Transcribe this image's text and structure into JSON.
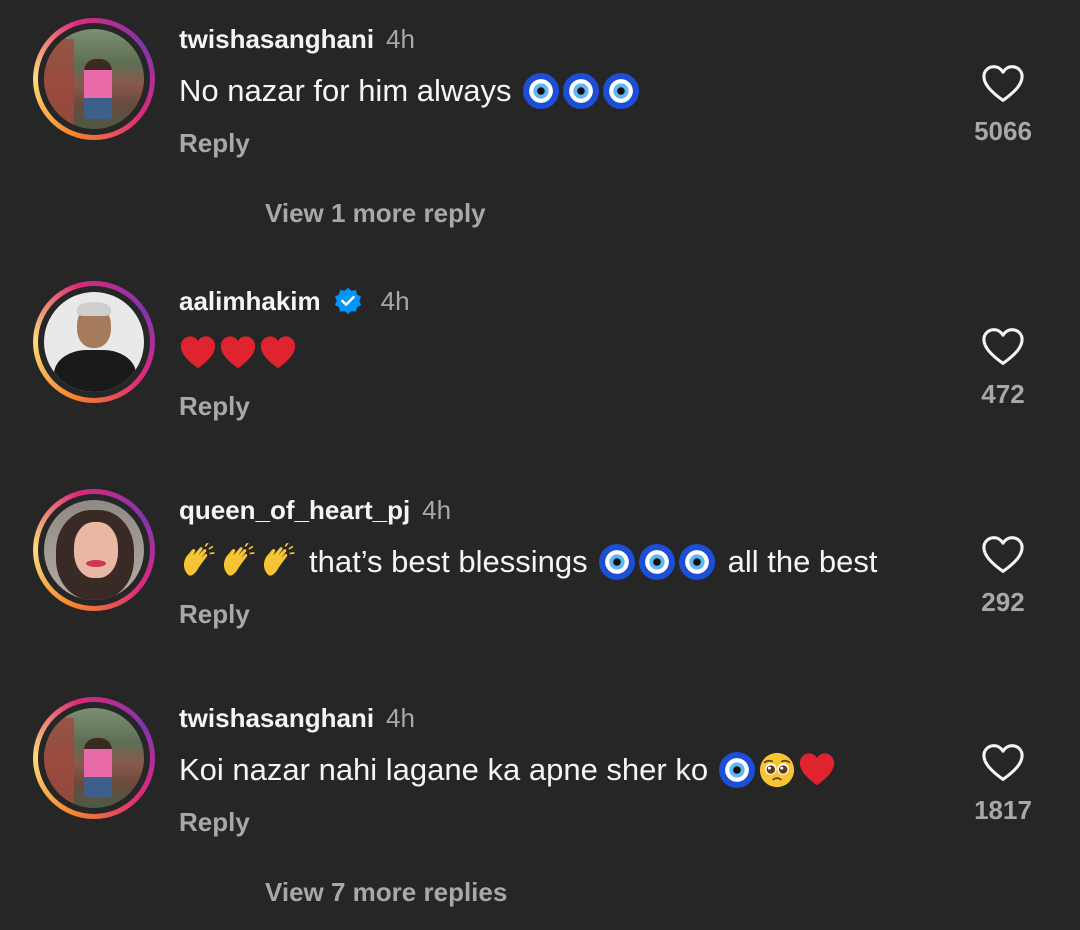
{
  "comments": [
    {
      "username": "twishasanghani",
      "time": "4h",
      "text": "No nazar for him always",
      "reply_label": "Reply",
      "likes": "5066",
      "view_more": "View 1 more reply"
    },
    {
      "username": "aalimhakim",
      "time": "4h",
      "verified": true,
      "reply_label": "Reply",
      "likes": "472"
    },
    {
      "username": "queen_of_heart_pj",
      "time": "4h",
      "text_a": "that’s best blessings",
      "text_b": "all the best",
      "reply_label": "Reply",
      "likes": "292"
    },
    {
      "username": "twishasanghani",
      "time": "4h",
      "text": "Koi nazar nahi lagane ka apne sher ko",
      "reply_label": "Reply",
      "likes": "1817",
      "view_more": "View 7 more replies"
    }
  ],
  "icons": {
    "like": "heart-outline-icon",
    "verified": "verified-badge-icon",
    "nazar": "nazar-amulet-emoji",
    "heart": "red-heart-emoji",
    "clap": "clapping-hands-emoji",
    "pleading": "pleading-face-emoji"
  },
  "colors": {
    "background": "#262626",
    "primary_text": "#f5f5f5",
    "secondary_text": "#a8a8a8",
    "verified": "#0095f6"
  }
}
